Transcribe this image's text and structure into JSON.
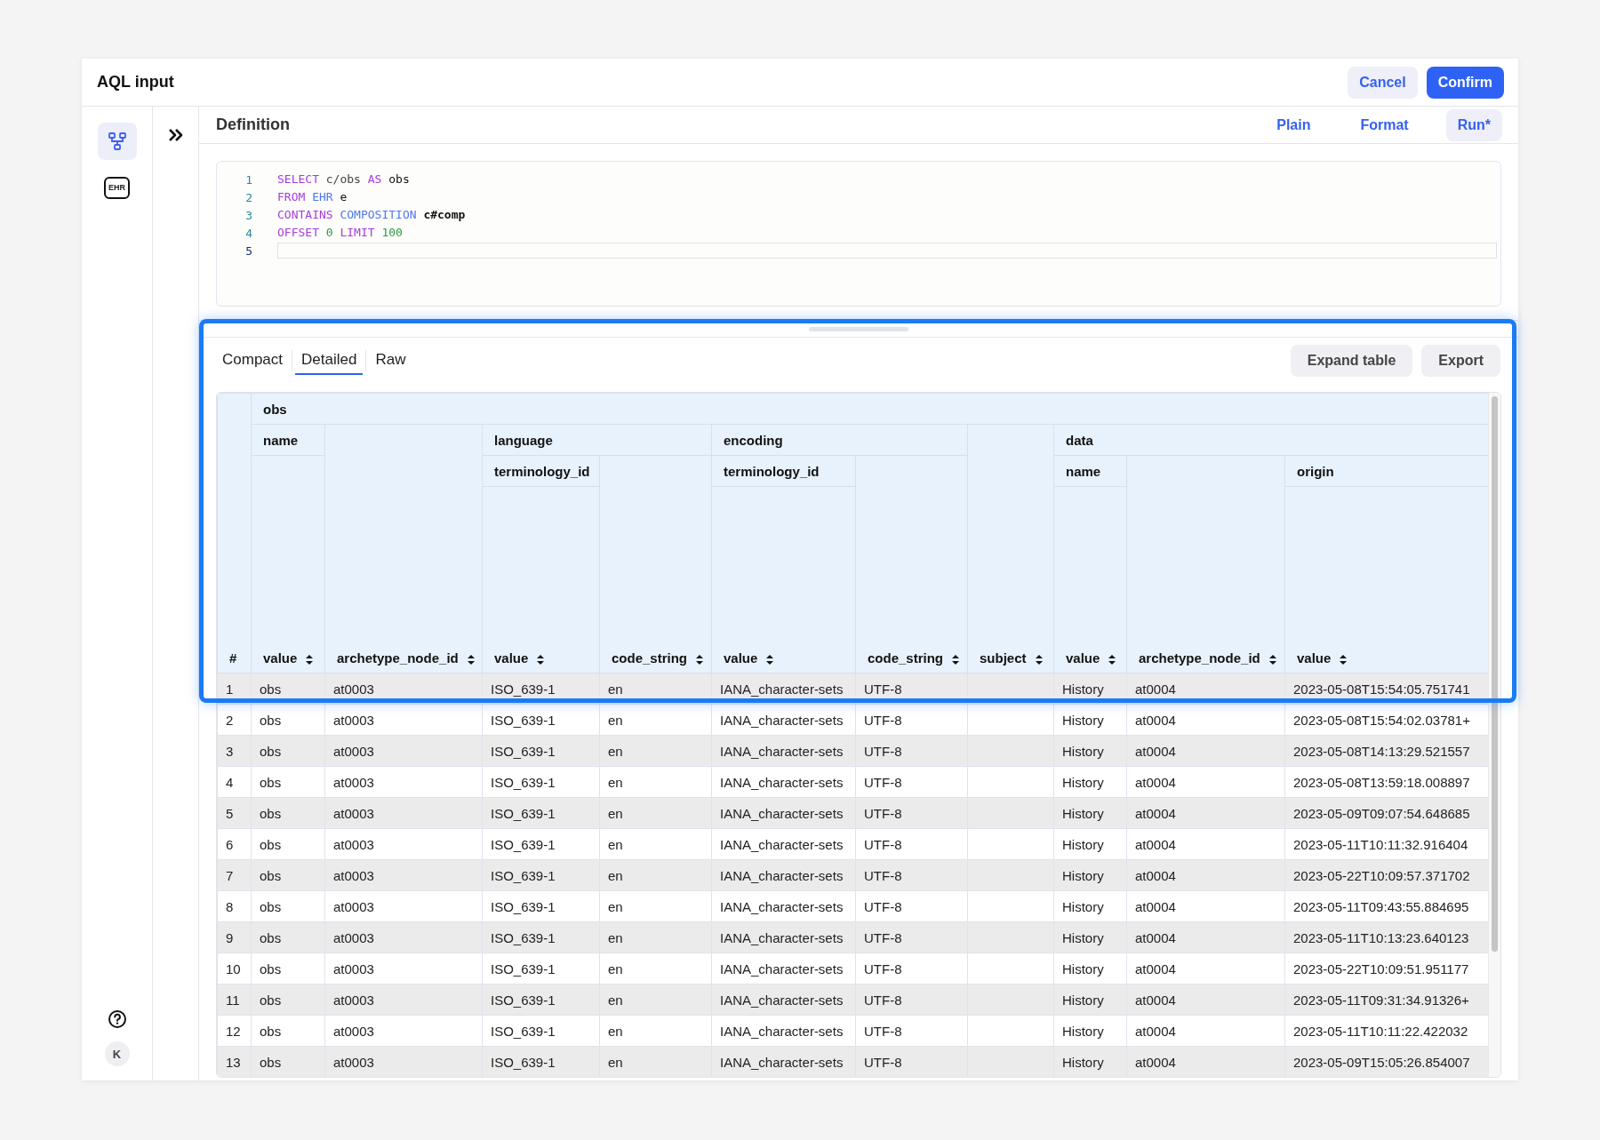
{
  "dialog": {
    "title": "AQL input",
    "buttons": [
      {
        "label": "Cancel",
        "kind": "secondary"
      },
      {
        "label": "Confirm",
        "kind": "primary"
      }
    ]
  },
  "rail": {
    "items": [
      {
        "kind": "tree",
        "selected": true
      },
      {
        "kind": "badge",
        "label": "EHR",
        "selected": false
      }
    ],
    "avatar": "K"
  },
  "definition": {
    "title": "Definition",
    "buttons": [
      {
        "label": "Plain",
        "kind": "link"
      },
      {
        "label": "Format",
        "kind": "link"
      },
      {
        "label": "Run*",
        "kind": "soft"
      }
    ]
  },
  "editor": {
    "lines": [
      {
        "number": "1",
        "active": false,
        "tokens": [
          {
            "text": "SELECT",
            "kind": "keyword"
          },
          {
            "text": "c/obs",
            "kind": "plain"
          },
          {
            "text": "AS",
            "kind": "keyword"
          },
          {
            "text": "obs",
            "kind": "name"
          }
        ]
      },
      {
        "number": "2",
        "active": false,
        "tokens": [
          {
            "text": "FROM",
            "kind": "keyword"
          },
          {
            "text": "EHR",
            "kind": "type"
          },
          {
            "text": "e",
            "kind": "name"
          }
        ]
      },
      {
        "number": "3",
        "active": false,
        "tokens": [
          {
            "text": "CONTAINS",
            "kind": "keyword"
          },
          {
            "text": "COMPOSITION",
            "kind": "type"
          },
          {
            "text": "c#comp",
            "kind": "strong"
          }
        ]
      },
      {
        "number": "4",
        "active": false,
        "tokens": [
          {
            "text": "OFFSET",
            "kind": "keyword"
          },
          {
            "text": "0",
            "kind": "number"
          },
          {
            "text": "LIMIT",
            "kind": "keyword"
          },
          {
            "text": "100",
            "kind": "number"
          }
        ]
      },
      {
        "number": "5",
        "active": true
      }
    ]
  },
  "results": {
    "highlighted": true,
    "tabs": [
      {
        "label": "Compact",
        "selected": false
      },
      {
        "label": "Detailed",
        "selected": true
      },
      {
        "label": "Raw",
        "selected": false
      }
    ],
    "buttons": [
      "Expand table",
      "Export"
    ],
    "columns": [
      {
        "label": "#",
        "sortable": false
      },
      {
        "label": "obs",
        "colspan": 10,
        "children": [
          {
            "label": "name",
            "children": [
              {
                "label": "value",
                "sortable": true
              }
            ]
          },
          {
            "label": "archetype_node_id",
            "sortable": true
          },
          {
            "label": "language",
            "colspan": 2,
            "children": [
              {
                "label": "terminology_id",
                "children": [
                  {
                    "label": "value",
                    "sortable": true
                  }
                ]
              },
              {
                "label": "code_string",
                "sortable": true
              }
            ]
          },
          {
            "label": "encoding",
            "colspan": 2,
            "children": [
              {
                "label": "terminology_id",
                "children": [
                  {
                    "label": "value",
                    "sortable": true
                  }
                ]
              },
              {
                "label": "code_string",
                "sortable": true
              }
            ]
          },
          {
            "label": "subject",
            "sortable": true
          },
          {
            "label": "data",
            "colspan": 3,
            "children": [
              {
                "label": "name",
                "children": [
                  {
                    "label": "value",
                    "sortable": true
                  }
                ]
              },
              {
                "label": "archetype_node_id",
                "sortable": true
              },
              {
                "label": "origin",
                "children": [
                  {
                    "label": "value",
                    "sortable": true
                  }
                ]
              }
            ]
          }
        ]
      }
    ],
    "rows": [
      [
        "1",
        "obs",
        "at0003",
        "ISO_639-1",
        "en",
        "IANA_character-sets",
        "UTF-8",
        null,
        "History",
        "at0004",
        "2023-05-08T15:54:05.751741"
      ],
      [
        "2",
        "obs",
        "at0003",
        "ISO_639-1",
        "en",
        "IANA_character-sets",
        "UTF-8",
        null,
        "History",
        "at0004",
        "2023-05-08T15:54:02.03781+"
      ],
      [
        "3",
        "obs",
        "at0003",
        "ISO_639-1",
        "en",
        "IANA_character-sets",
        "UTF-8",
        null,
        "History",
        "at0004",
        "2023-05-08T14:13:29.521557"
      ],
      [
        "4",
        "obs",
        "at0003",
        "ISO_639-1",
        "en",
        "IANA_character-sets",
        "UTF-8",
        null,
        "History",
        "at0004",
        "2023-05-08T13:59:18.008897"
      ],
      [
        "5",
        "obs",
        "at0003",
        "ISO_639-1",
        "en",
        "IANA_character-sets",
        "UTF-8",
        null,
        "History",
        "at0004",
        "2023-05-09T09:07:54.648685"
      ],
      [
        "6",
        "obs",
        "at0003",
        "ISO_639-1",
        "en",
        "IANA_character-sets",
        "UTF-8",
        null,
        "History",
        "at0004",
        "2023-05-11T10:11:32.916404"
      ],
      [
        "7",
        "obs",
        "at0003",
        "ISO_639-1",
        "en",
        "IANA_character-sets",
        "UTF-8",
        null,
        "History",
        "at0004",
        "2023-05-22T10:09:57.371702"
      ],
      [
        "8",
        "obs",
        "at0003",
        "ISO_639-1",
        "en",
        "IANA_character-sets",
        "UTF-8",
        null,
        "History",
        "at0004",
        "2023-05-11T09:43:55.884695"
      ],
      [
        "9",
        "obs",
        "at0003",
        "ISO_639-1",
        "en",
        "IANA_character-sets",
        "UTF-8",
        null,
        "History",
        "at0004",
        "2023-05-11T10:13:23.640123"
      ],
      [
        "10",
        "obs",
        "at0003",
        "ISO_639-1",
        "en",
        "IANA_character-sets",
        "UTF-8",
        null,
        "History",
        "at0004",
        "2023-05-22T10:09:51.951177"
      ],
      [
        "11",
        "obs",
        "at0003",
        "ISO_639-1",
        "en",
        "IANA_character-sets",
        "UTF-8",
        null,
        "History",
        "at0004",
        "2023-05-11T09:31:34.91326+"
      ],
      [
        "12",
        "obs",
        "at0003",
        "ISO_639-1",
        "en",
        "IANA_character-sets",
        "UTF-8",
        null,
        "History",
        "at0004",
        "2023-05-11T10:11:22.422032"
      ],
      [
        "13",
        "obs",
        "at0003",
        "ISO_639-1",
        "en",
        "IANA_character-sets",
        "UTF-8",
        null,
        "History",
        "at0004",
        "2023-05-09T15:05:26.854007"
      ]
    ]
  }
}
